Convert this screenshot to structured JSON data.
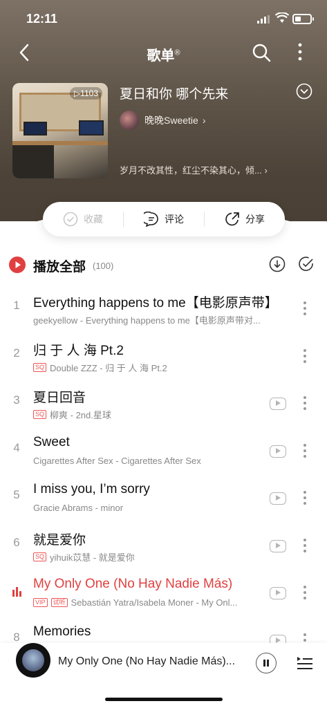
{
  "status": {
    "time": "12:11"
  },
  "nav": {
    "title": "歌单",
    "title_mark": "®"
  },
  "playlist": {
    "play_count": "▷1103",
    "title": "夏日和你 哪个先来",
    "creator": "晚晚Sweetie",
    "description": "岁月不改其性，红尘不染其心，倾..."
  },
  "actions": {
    "favorite": "收藏",
    "comment": "评论",
    "share": "分享"
  },
  "play_all": {
    "label": "播放全部",
    "count": "(100)"
  },
  "songs": [
    {
      "num": "1",
      "title": "Everything happens to me【电影原声带】",
      "sub": "geekyellow - Everything happens to me【电影原声带对...",
      "badges": [],
      "mv": false
    },
    {
      "num": "2",
      "title": "归 于 人 海 Pt.2",
      "sub": "Double ZZZ - 归 于 人 海 Pt.2",
      "badges": [
        "SQ"
      ],
      "mv": false
    },
    {
      "num": "3",
      "title": "夏日回音",
      "sub": "柳爽 - 2nd.星球",
      "badges": [
        "SQ"
      ],
      "mv": true
    },
    {
      "num": "4",
      "title": "Sweet",
      "sub": "Cigarettes After Sex - Cigarettes After Sex",
      "badges": [],
      "mv": true
    },
    {
      "num": "5",
      "title": "I miss you, I’m sorry",
      "sub": "Gracie Abrams - minor",
      "badges": [],
      "mv": true
    },
    {
      "num": "6",
      "title": "就是爱你",
      "sub": "yihuik苡慧 - 就是爱你",
      "badges": [
        "SQ"
      ],
      "mv": true
    },
    {
      "num": "",
      "title": "My Only One (No Hay Nadie Más)",
      "sub": "Sebastián Yatra/Isabela Moner - My Onl...",
      "badges": [
        "VIP",
        "试听"
      ],
      "mv": true,
      "active": true
    },
    {
      "num": "8",
      "title": "Memories",
      "sub": "",
      "badges": [],
      "mv": true
    }
  ],
  "player": {
    "now_playing": "My Only One (No Hay Nadie Más)..."
  },
  "colors": {
    "accent": "#e04040",
    "hero": "#5f5448"
  },
  "icons": [
    "back-icon",
    "search-icon",
    "more-icon",
    "chevron-down-icon",
    "check-circle-icon",
    "comment-icon",
    "share-icon",
    "play-circle-icon",
    "download-icon",
    "multi-select-icon",
    "mv-icon",
    "equalizer-icon",
    "pause-icon",
    "queue-icon"
  ]
}
